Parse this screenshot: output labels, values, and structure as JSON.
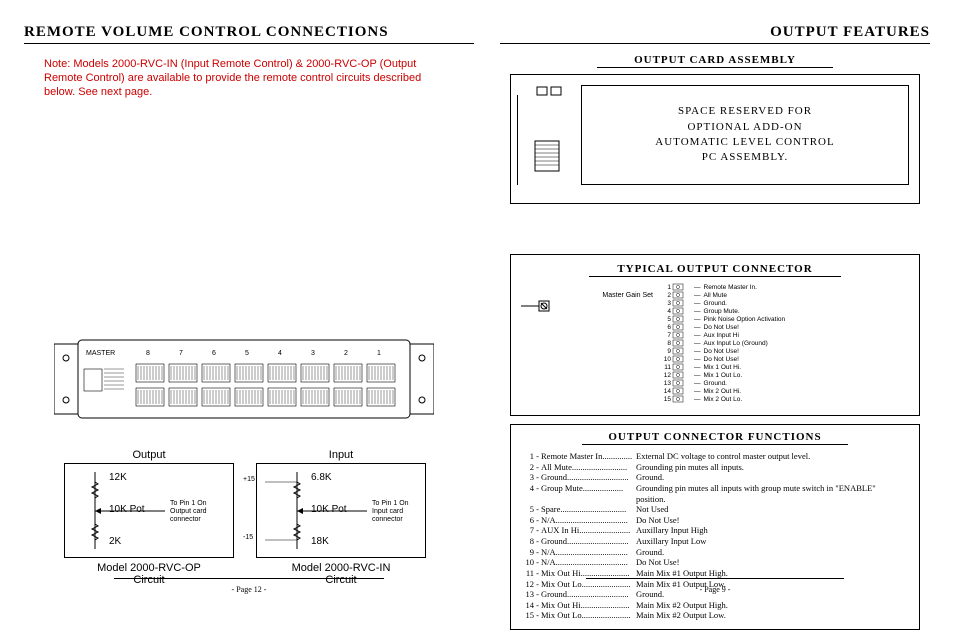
{
  "left": {
    "title": "REMOTE  VOLUME  CONTROL  CONNECTIONS",
    "note": "Note: Models 2000-RVC-IN (Input Remote Control) & 2000-RVC-OP (Output Remote Control) are available to provide the remote control circuits described below. See next page.",
    "chassis": {
      "master": "MASTER",
      "slots": [
        "8",
        "7",
        "6",
        "5",
        "4",
        "3",
        "2",
        "1"
      ]
    },
    "output_circuit": {
      "heading": "Output",
      "r1": "12K",
      "pot": "10K Pot",
      "r2": "2K",
      "note1": "To Pin 1 On",
      "note2": "Output card",
      "note3": "connector",
      "model": "Model 2000-RVC-OP",
      "sub": "Circuit"
    },
    "input_circuit": {
      "heading": "Input",
      "r1": "6.8K",
      "pot": "10K Pot",
      "r2": "18K",
      "plus": "+15",
      "minus": "-15",
      "note1": "To Pin 1 On",
      "note2": "Input card",
      "note3": "connector",
      "model": "Model 2000-RVC-IN",
      "sub": "Circuit"
    },
    "pagenum": "- Page  12 -"
  },
  "right": {
    "title": "OUTPUT  FEATURES",
    "card_hdr": "OUTPUT  CARD  ASSEMBLY",
    "addon1": "SPACE  RESERVED  FOR",
    "addon2": "OPTIONAL  ADD-ON",
    "addon3": "AUTOMATIC  LEVEL  CONTROL",
    "addon4": "PC  ASSEMBLY.",
    "conn_hdr": "TYPICAL   OUTPUT   CONNECTOR",
    "gain": "Master Gain  Set",
    "pins": [
      {
        "n": "1",
        "label": "Remote  Master In."
      },
      {
        "n": "2",
        "label": "All  Mute"
      },
      {
        "n": "3",
        "label": "Ground."
      },
      {
        "n": "4",
        "label": "Group  Mute."
      },
      {
        "n": "5",
        "label": "Pink Noise Option Activation"
      },
      {
        "n": "6",
        "label": "Do Not Use!"
      },
      {
        "n": "7",
        "label": "Aux Input Hi"
      },
      {
        "n": "8",
        "label": "Aux Input Lo (Ground)"
      },
      {
        "n": "9",
        "label": "Do Not Use!"
      },
      {
        "n": "10",
        "label": "Do Not Use!"
      },
      {
        "n": "11",
        "label": "Mix 1 Out Hi."
      },
      {
        "n": "12",
        "label": "Mix 1 Out Lo."
      },
      {
        "n": "13",
        "label": "Ground."
      },
      {
        "n": "14",
        "label": "Mix 2 Out Hi."
      },
      {
        "n": "15",
        "label": "Mix 2 Out  Lo."
      }
    ],
    "func_hdr": "OUTPUT   CONNECTOR   FUNCTIONS",
    "funcs": [
      {
        "n": "1",
        "name": "Remote  Master In",
        "dots": "..............",
        "desc": "External DC voltage to control master output level."
      },
      {
        "n": "2",
        "name": "All  Mute",
        "dots": "..........................",
        "desc": "Grounding pin mutes all inputs."
      },
      {
        "n": "3",
        "name": "Ground",
        "dots": ".............................",
        "desc": "Ground."
      },
      {
        "n": "4",
        "name": "Group  Mute",
        "dots": "...................",
        "desc": "Grounding pin mutes all inputs with group mute switch in \"ENABLE\" position."
      },
      {
        "n": "5",
        "name": "Spare",
        "dots": "...............................",
        "desc": "Not Used"
      },
      {
        "n": "6",
        "name": "N/A",
        "dots": "..................................",
        "desc": "Do Not Use!"
      },
      {
        "n": "7",
        "name": "AUX In Hi",
        "dots": "........................",
        "desc": "Auxillary Input High"
      },
      {
        "n": "8",
        "name": "Ground",
        "dots": ".............................",
        "desc": "Auxillary Input Low"
      },
      {
        "n": "9",
        "name": "N/A",
        "dots": "..................................",
        "desc": "Ground."
      },
      {
        "n": "10",
        "name": "N/A",
        "dots": "..................................",
        "desc": "Do Not Use!"
      },
      {
        "n": "11",
        "name": "Mix Out Hi",
        "dots": ".......................",
        "desc": "Main Mix #1 Output High."
      },
      {
        "n": "12",
        "name": "Mix Out Lo",
        "dots": ".......................",
        "desc": "Main Mix #1 Output Low."
      },
      {
        "n": "13",
        "name": "Ground",
        "dots": ".............................",
        "desc": "Ground."
      },
      {
        "n": "14",
        "name": "Mix Out Hi",
        "dots": ".......................",
        "desc": "Main Mix #2 Output High."
      },
      {
        "n": "15",
        "name": "Mix Out Lo",
        "dots": ".......................",
        "desc": "Main Mix #2 Output Low."
      }
    ],
    "pagenum": "- Page  9 -"
  }
}
